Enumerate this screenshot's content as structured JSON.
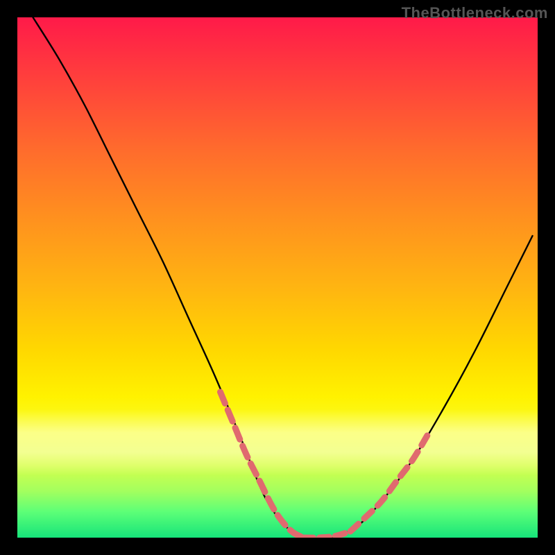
{
  "watermark": "TheBottleneck.com",
  "chart_data": {
    "type": "line",
    "title": "",
    "xlabel": "",
    "ylabel": "",
    "xlim": [
      0,
      100
    ],
    "ylim": [
      0,
      100
    ],
    "grid": false,
    "series": [
      {
        "name": "main-curve",
        "color": "#000000",
        "x": [
          3,
          8,
          13,
          18,
          23,
          28,
          33,
          38,
          43,
          47,
          50,
          53,
          56,
          60,
          65,
          70,
          76,
          82,
          88,
          94,
          99
        ],
        "y": [
          100,
          92,
          83,
          73,
          63,
          53,
          42,
          31,
          19,
          9,
          4,
          1,
          0,
          0,
          2,
          7,
          15,
          25,
          36,
          48,
          58
        ]
      }
    ],
    "highlight_segments": [
      {
        "name": "descending-near-bottom",
        "color": "#e06a6f",
        "stroke_width": 9,
        "dash": "18 10",
        "x": [
          39,
          41.5,
          44,
          46.5,
          49,
          51,
          53,
          55
        ],
        "y": [
          28,
          22,
          16,
          11,
          6,
          3,
          1,
          0
        ]
      },
      {
        "name": "valley-floor",
        "color": "#e06a6f",
        "stroke_width": 9,
        "dash": "14 9",
        "x": [
          55,
          58,
          61,
          64
        ],
        "y": [
          0,
          0,
          0.3,
          1.2
        ]
      },
      {
        "name": "ascending-near-bottom",
        "color": "#e06a6f",
        "stroke_width": 9,
        "dash": "16 11",
        "x": [
          64,
          67,
          70,
          73,
          76,
          79
        ],
        "y": [
          1.2,
          4,
          7,
          11,
          15,
          20
        ]
      }
    ],
    "gradient_stops": [
      {
        "pos": 0,
        "color": "#ff1a49"
      },
      {
        "pos": 10,
        "color": "#ff3a3e"
      },
      {
        "pos": 25,
        "color": "#ff6a2d"
      },
      {
        "pos": 38,
        "color": "#ff8f1f"
      },
      {
        "pos": 52,
        "color": "#ffb511"
      },
      {
        "pos": 64,
        "color": "#ffd800"
      },
      {
        "pos": 73,
        "color": "#fff200"
      },
      {
        "pos": 80,
        "color": "#f7ff2e"
      },
      {
        "pos": 86,
        "color": "#d6ff4a"
      },
      {
        "pos": 91,
        "color": "#a4ff5e"
      },
      {
        "pos": 95,
        "color": "#5dff77"
      },
      {
        "pos": 100,
        "color": "#16e47a"
      }
    ]
  }
}
